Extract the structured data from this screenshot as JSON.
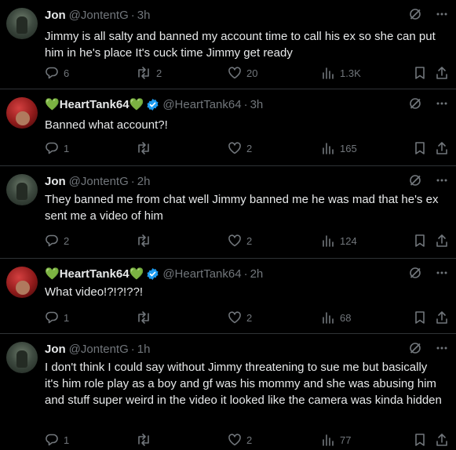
{
  "tweets": [
    {
      "name": "Jon",
      "handle": "@JontentG",
      "time": "3h",
      "text": "Jimmy is all salty and banned my account time to call his ex so she can put him in he's place It's cuck time Jimmy get ready",
      "replies": "6",
      "retweets": "2",
      "likes": "20",
      "views": "1.3K"
    },
    {
      "name_heart_left": "💚",
      "name": "HeartTank64",
      "name_heart_right": "💚",
      "handle": "@HeartTank64",
      "time": "3h",
      "text": "Banned what account?!",
      "replies": "1",
      "retweets": "",
      "likes": "2",
      "views": "165"
    },
    {
      "name": "Jon",
      "handle": "@JontentG",
      "time": "2h",
      "text": "They banned me from chat well Jimmy banned me he was mad that he's ex sent me a video of him",
      "replies": "2",
      "retweets": "",
      "likes": "2",
      "views": "124"
    },
    {
      "name_heart_left": "💚",
      "name": "HeartTank64",
      "name_heart_right": "💚",
      "handle": "@HeartTank64",
      "time": "2h",
      "text": "What video!?!?!??!",
      "replies": "1",
      "retweets": "",
      "likes": "2",
      "views": "68"
    },
    {
      "name": "Jon",
      "handle": "@JontentG",
      "time": "1h",
      "text": "I don't think I could say without Jimmy threatening to sue me but basically it's him role play as a boy and gf was his mommy and she was abusing him and stuff super weird in the video it looked like the camera was kinda hidden",
      "replies": "1",
      "retweets": "",
      "likes": "2",
      "views": "77"
    }
  ],
  "separator": "·",
  "colors": {
    "background": "#000000",
    "text": "#e7e9ea",
    "muted": "#71767b",
    "divider": "#2f3336",
    "verified": "#1d9bf0",
    "heart_green": "#4caf50"
  },
  "icons": [
    "grok-icon",
    "more-icon",
    "reply-icon",
    "retweet-icon",
    "like-icon",
    "views-icon",
    "bookmark-icon",
    "share-icon",
    "verified-badge-icon"
  ]
}
